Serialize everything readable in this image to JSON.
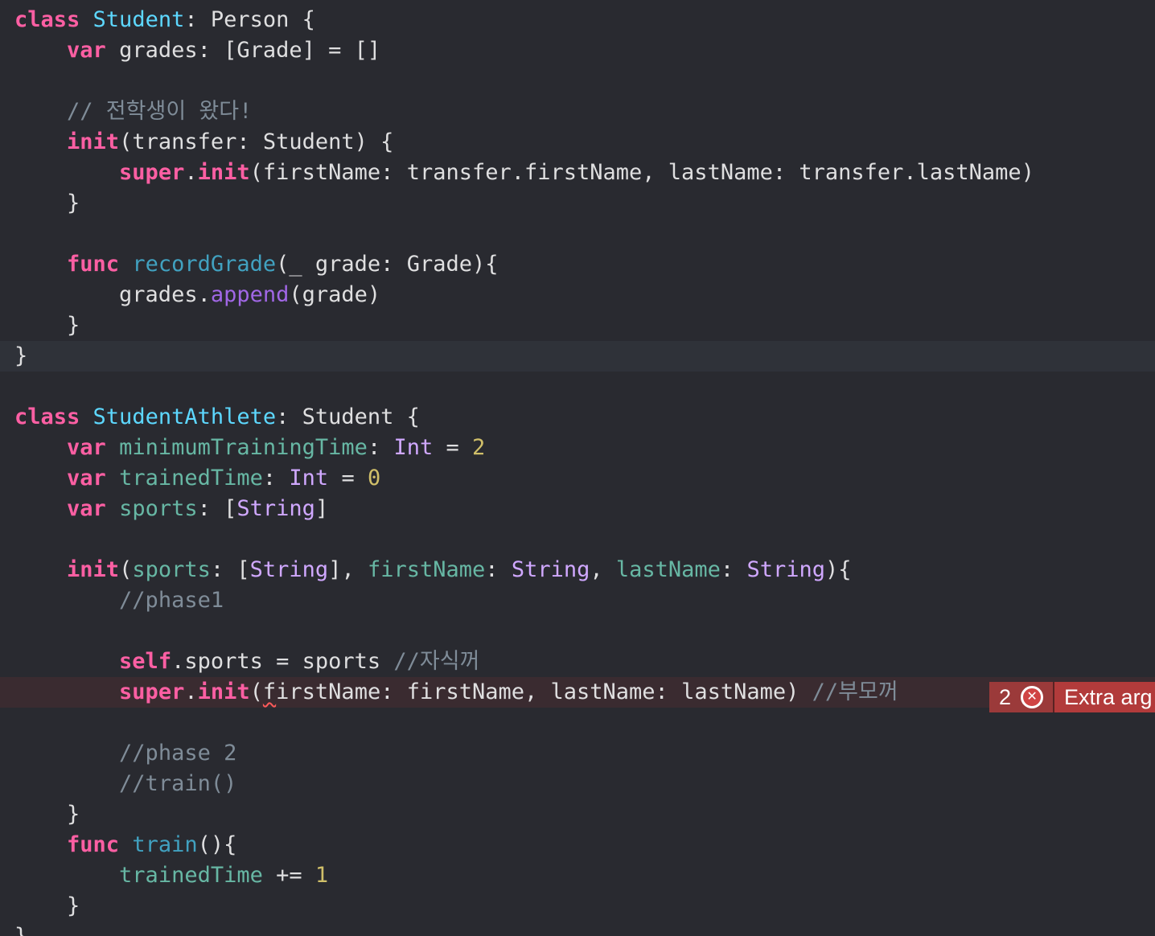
{
  "colors": {
    "background": "#292a30",
    "keyword": "#fc5fa3",
    "type_declaration": "#5dd8ff",
    "type": "#d0a8ff",
    "property": "#67b7a4",
    "function": "#41a1c0",
    "system_method": "#a167e6",
    "number": "#d0bf69",
    "comment": "#7f8c98",
    "plain": "#dfdfe0",
    "error": "#b23b3b"
  },
  "code": [
    [
      [
        "kw",
        "class"
      ],
      [
        "pl",
        " "
      ],
      [
        "td",
        "Student"
      ],
      [
        "pl",
        ": Person {"
      ]
    ],
    [
      [
        "pl",
        "    "
      ],
      [
        "kw",
        "var"
      ],
      [
        "pl",
        " grades: [Grade] = []"
      ]
    ],
    [],
    [
      [
        "pl",
        "    "
      ],
      [
        "cm",
        "// 전학생이 왔다!"
      ]
    ],
    [
      [
        "pl",
        "    "
      ],
      [
        "kw",
        "init"
      ],
      [
        "pl",
        "(transfer: Student) {"
      ]
    ],
    [
      [
        "pl",
        "        "
      ],
      [
        "kw",
        "super"
      ],
      [
        "pl",
        "."
      ],
      [
        "kw",
        "init"
      ],
      [
        "pl",
        "(firstName: transfer.firstName, lastName: transfer.lastName)"
      ]
    ],
    [
      [
        "pl",
        "    }"
      ]
    ],
    [],
    [
      [
        "pl",
        "    "
      ],
      [
        "kw",
        "func"
      ],
      [
        "pl",
        " "
      ],
      [
        "fn",
        "recordGrade"
      ],
      [
        "pl",
        "(_ grade: Grade){"
      ]
    ],
    [
      [
        "pl",
        "        grades."
      ],
      [
        "pt",
        "append"
      ],
      [
        "pl",
        "(grade)"
      ]
    ],
    [
      [
        "pl",
        "    }"
      ]
    ],
    [
      [
        "pl",
        "}"
      ]
    ],
    [],
    [
      [
        "kw",
        "class"
      ],
      [
        "pl",
        " "
      ],
      [
        "td",
        "StudentAthlete"
      ],
      [
        "pl",
        ": Student {"
      ]
    ],
    [
      [
        "pl",
        "    "
      ],
      [
        "kw",
        "var"
      ],
      [
        "pl",
        " "
      ],
      [
        "pr",
        "minimumTrainingTime"
      ],
      [
        "pl",
        ": "
      ],
      [
        "ty",
        "Int"
      ],
      [
        "pl",
        " = "
      ],
      [
        "num",
        "2"
      ]
    ],
    [
      [
        "pl",
        "    "
      ],
      [
        "kw",
        "var"
      ],
      [
        "pl",
        " "
      ],
      [
        "pr",
        "trainedTime"
      ],
      [
        "pl",
        ": "
      ],
      [
        "ty",
        "Int"
      ],
      [
        "pl",
        " = "
      ],
      [
        "num",
        "0"
      ]
    ],
    [
      [
        "pl",
        "    "
      ],
      [
        "kw",
        "var"
      ],
      [
        "pl",
        " "
      ],
      [
        "pr",
        "sports"
      ],
      [
        "pl",
        ": ["
      ],
      [
        "ty",
        "String"
      ],
      [
        "pl",
        "]"
      ]
    ],
    [],
    [
      [
        "pl",
        "    "
      ],
      [
        "kw",
        "init"
      ],
      [
        "pl",
        "("
      ],
      [
        "pr",
        "sports"
      ],
      [
        "pl",
        ": ["
      ],
      [
        "ty",
        "String"
      ],
      [
        "pl",
        "], "
      ],
      [
        "pr",
        "firstName"
      ],
      [
        "pl",
        ": "
      ],
      [
        "ty",
        "String"
      ],
      [
        "pl",
        ", "
      ],
      [
        "pr",
        "lastName"
      ],
      [
        "pl",
        ": "
      ],
      [
        "ty",
        "String"
      ],
      [
        "pl",
        "){"
      ]
    ],
    [
      [
        "pl",
        "        "
      ],
      [
        "cm",
        "//phase1"
      ]
    ],
    [],
    [
      [
        "pl",
        "        "
      ],
      [
        "kw",
        "self"
      ],
      [
        "pl",
        ".sports = sports "
      ],
      [
        "cm",
        "//자식꺼"
      ]
    ],
    [
      [
        "pl",
        "        "
      ],
      [
        "kw",
        "super"
      ],
      [
        "pl",
        "."
      ],
      [
        "kw",
        "init"
      ],
      [
        "pl",
        "("
      ],
      [
        "pl",
        "f"
      ],
      [
        "pl",
        "irstName: firstName, lastName: lastName) "
      ],
      [
        "cm",
        "//부모꺼"
      ]
    ],
    [],
    [
      [
        "pl",
        "        "
      ],
      [
        "cm",
        "//phase 2"
      ]
    ],
    [
      [
        "pl",
        "        "
      ],
      [
        "cm",
        "//train()"
      ]
    ],
    [
      [
        "pl",
        "    }"
      ]
    ],
    [
      [
        "pl",
        "    "
      ],
      [
        "kw",
        "func"
      ],
      [
        "pl",
        " "
      ],
      [
        "fn",
        "train"
      ],
      [
        "pl",
        "(){"
      ]
    ],
    [
      [
        "pl",
        "        "
      ],
      [
        "pr",
        "trainedTime"
      ],
      [
        "pl",
        " += "
      ],
      [
        "num",
        "1"
      ]
    ],
    [
      [
        "pl",
        "    }"
      ]
    ],
    [
      [
        "pl",
        "}"
      ]
    ]
  ],
  "error": {
    "count": "2",
    "icon": "error-x-circle-icon",
    "message": "Extra arg"
  }
}
